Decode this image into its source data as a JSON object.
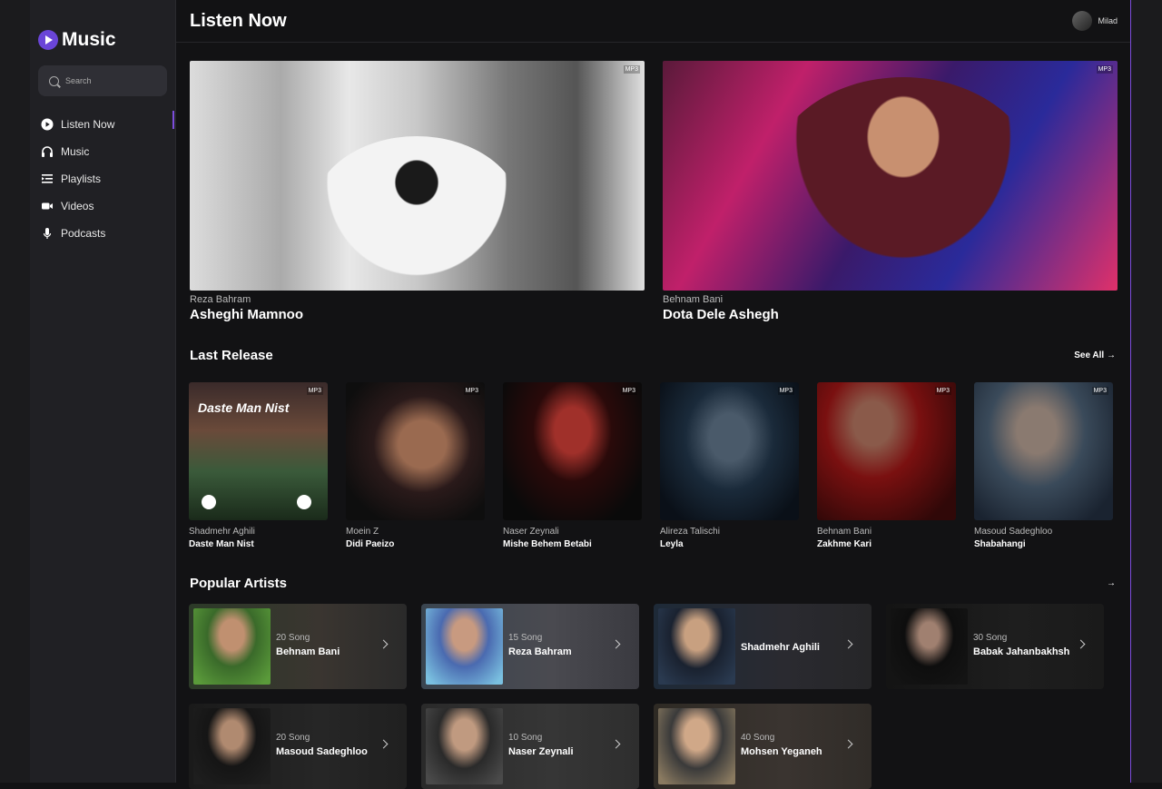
{
  "app": {
    "name": "Music",
    "accent": "#7c4ddb"
  },
  "search": {
    "placeholder": "Search"
  },
  "nav": [
    {
      "label": "Listen Now",
      "icon": "play-circle-icon",
      "active": true
    },
    {
      "label": "Music",
      "icon": "headphones-icon"
    },
    {
      "label": "Playlists",
      "icon": "playlist-icon"
    },
    {
      "label": "Videos",
      "icon": "video-camera-icon"
    },
    {
      "label": "Podcasts",
      "icon": "microphone-icon"
    }
  ],
  "header": {
    "title": "Listen Now",
    "user": "Milad"
  },
  "featured": [
    {
      "artist": "Reza Bahram",
      "title": "Asheghi Mamnoo",
      "badge": "MP3"
    },
    {
      "artist": "Behnam Bani",
      "title": "Dota Dele Ashegh",
      "badge": "MP3"
    }
  ],
  "last_release": {
    "title": "Last Release",
    "see_all": "See All",
    "items": [
      {
        "artist": "Shadmehr Aghili",
        "title": "Daste Man Nist",
        "badge": "MP3",
        "cover_text": "Daste Man Nist"
      },
      {
        "artist": "Moein Z",
        "title": "Didi Paeizo",
        "badge": "MP3"
      },
      {
        "artist": "Naser Zeynali",
        "title": "Mishe Behem Betabi",
        "badge": "MP3"
      },
      {
        "artist": "Alireza Talischi",
        "title": "Leyla",
        "badge": "MP3"
      },
      {
        "artist": "Behnam Bani",
        "title": "Zakhme Kari",
        "badge": "MP3"
      },
      {
        "artist": "Masoud Sadeghloo",
        "title": "Shabahangi",
        "badge": "MP3"
      }
    ]
  },
  "popular_artists": {
    "title": "Popular Artists",
    "items": [
      {
        "name": "Behnam Bani",
        "count": "20 Song"
      },
      {
        "name": "Reza Bahram",
        "count": "15 Song"
      },
      {
        "name": "Shadmehr Aghili",
        "count": ""
      },
      {
        "name": "Babak Jahanbakhsh",
        "count": "30 Song"
      },
      {
        "name": "Masoud Sadeghloo",
        "count": "20 Song"
      },
      {
        "name": "Naser Zeynali",
        "count": "10 Song"
      },
      {
        "name": "Mohsen Yeganeh",
        "count": "40 Song"
      }
    ]
  }
}
